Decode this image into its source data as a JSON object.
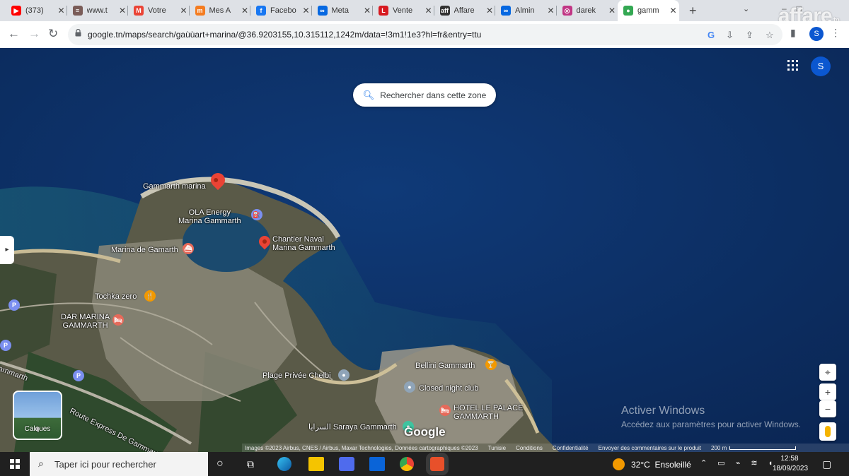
{
  "browser": {
    "tabs": [
      {
        "title": "(373)",
        "icon": "youtube-icon",
        "color": "#ff0000"
      },
      {
        "title": "www.t",
        "icon": "site-icon",
        "color": "#7a5c58"
      },
      {
        "title": "Votre",
        "icon": "gmail-icon",
        "color": "#ea4335"
      },
      {
        "title": "Mes A",
        "icon": "m-icon",
        "color": "#f47c20"
      },
      {
        "title": "Facebo",
        "icon": "facebook-icon",
        "color": "#1877f2"
      },
      {
        "title": "Meta",
        "icon": "meta-icon",
        "color": "#0668e1"
      },
      {
        "title": "Vente",
        "icon": "l-icon",
        "color": "#d71920"
      },
      {
        "title": "Affare",
        "icon": "aff-icon",
        "color": "#333333"
      },
      {
        "title": "Almin",
        "icon": "infinity-icon",
        "color": "#0668e1"
      },
      {
        "title": "darek",
        "icon": "instagram-icon",
        "color": "#c13584"
      },
      {
        "title": "gamm",
        "icon": "maps-pin-icon",
        "color": "#34a853"
      }
    ],
    "active_tab": 10,
    "new_tab_label": "+",
    "watermark": "affare",
    "watermark_tld": ".tn",
    "url": "google.tn/maps/search/gaùùart+marina/@36.9203155,10.315112,1242m/data=!3m1!1e3?hl=fr&entry=ttu",
    "profile_initial": "S"
  },
  "map": {
    "search_area_button": "Rechercher dans cette zone",
    "account_initial": "S",
    "labels": {
      "gammarth_marina": "Gammarth marina",
      "ola_energy": "OLA Energy\nMarina Gammarth",
      "chantier_naval": "Chantier Naval\nMarina Gammarth",
      "marina_de_gamarth": "Marina de Gamarth",
      "tochka_zero": "Tochka zero",
      "dar_marina": "DAR MARINA\nGAMMARTH",
      "plage_privee": "Plage Privée Chelbi",
      "bellini": "Bellini Gammarth",
      "closed_night": "Closed night club",
      "hotel_le_palace": "HOTEL LE PALACE\nGAMMARTH",
      "saraya": "السرايا Saraya Gammarth",
      "road": "Route Express De Gammarth",
      "road_left": "ammarth"
    },
    "layers_label": "Calques",
    "zoom_in": "+",
    "zoom_out": "−",
    "google_logo": "Google",
    "attribution": {
      "imagery": "Images ©2023 Airbus, CNES / Airbus, Maxar Technologies, Données cartographiques ©2023",
      "country": "Tunisie",
      "terms": "Conditions",
      "privacy": "Confidentialité",
      "feedback": "Envoyer des commentaires sur le produit",
      "scale": "200 m"
    }
  },
  "windows_activation": {
    "title": "Activer Windows",
    "subtitle": "Accédez aux paramètres pour activer Windows."
  },
  "taskbar": {
    "search_placeholder": "Taper ici pour rechercher",
    "weather_temp": "32°C",
    "weather_desc": "Ensoleillé",
    "time": "12:58",
    "date": "18/09/2023"
  }
}
